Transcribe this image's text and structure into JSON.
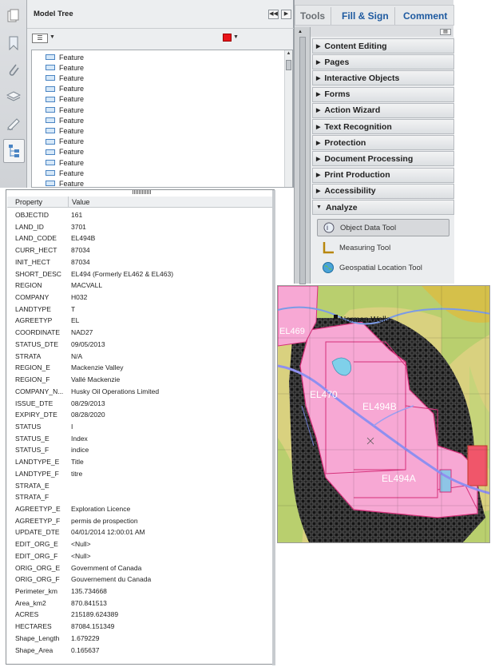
{
  "left_rail": {
    "icons": [
      "pages-icon",
      "bookmarks-icon",
      "attachments-icon",
      "layers-icon",
      "signatures-icon",
      "model-tree-icon"
    ]
  },
  "model_tree": {
    "title": "Model Tree",
    "nav_prev": "◀◀",
    "nav_next": "▶",
    "options_icon": "list-options-icon",
    "color_swatch": "#e8141a",
    "items": [
      "Feature",
      "Feature",
      "Feature",
      "Feature",
      "Feature",
      "Feature",
      "Feature",
      "Feature",
      "Feature",
      "Feature",
      "Feature",
      "Feature",
      "Feature"
    ]
  },
  "tools_panel": {
    "tabs": [
      "Tools",
      "Fill & Sign",
      "Comment"
    ],
    "accent": "#1e5aa0",
    "sections": [
      "Content Editing",
      "Pages",
      "Interactive Objects",
      "Forms",
      "Action Wizard",
      "Text Recognition",
      "Protection",
      "Document Processing",
      "Print Production",
      "Accessibility"
    ],
    "open_section": "Analyze",
    "analyze_tools": [
      {
        "label": "Object Data Tool",
        "icon": "object-data-icon"
      },
      {
        "label": "Measuring Tool",
        "icon": "ruler-icon"
      },
      {
        "label": "Geospatial Location Tool",
        "icon": "globe-icon"
      }
    ]
  },
  "properties": {
    "col_property": "Property",
    "col_value": "Value",
    "rows": [
      {
        "k": "OBJECTID",
        "v": "161"
      },
      {
        "k": "LAND_ID",
        "v": "3701"
      },
      {
        "k": "LAND_CODE",
        "v": "EL494B"
      },
      {
        "k": "CURR_HECT",
        "v": "87034"
      },
      {
        "k": "INIT_HECT",
        "v": "87034"
      },
      {
        "k": "SHORT_DESC",
        "v": "EL494 (Formerly EL462 & EL463)"
      },
      {
        "k": "REGION",
        "v": "MACVALL"
      },
      {
        "k": "COMPANY",
        "v": "H032"
      },
      {
        "k": "LANDTYPE",
        "v": "T"
      },
      {
        "k": "AGREETYP",
        "v": "EL"
      },
      {
        "k": "COORDINATE",
        "v": "NAD27"
      },
      {
        "k": "STATUS_DTE",
        "v": "09/05/2013"
      },
      {
        "k": "STRATA",
        "v": "N/A"
      },
      {
        "k": "REGION_E",
        "v": "Mackenzie Valley"
      },
      {
        "k": "REGION_F",
        "v": "Vallé Mackenzie"
      },
      {
        "k": "COMPANY_N...",
        "v": "Husky Oil Operations Limited"
      },
      {
        "k": "ISSUE_DTE",
        "v": "08/29/2013"
      },
      {
        "k": "EXPIRY_DTE",
        "v": "08/28/2020"
      },
      {
        "k": "STATUS",
        "v": "I"
      },
      {
        "k": "STATUS_E",
        "v": "Index"
      },
      {
        "k": "STATUS_F",
        "v": "indice"
      },
      {
        "k": "LANDTYPE_E",
        "v": "Title"
      },
      {
        "k": "LANDTYPE_F",
        "v": "titre"
      },
      {
        "k": "STRATA_E",
        "v": ""
      },
      {
        "k": "STRATA_F",
        "v": ""
      },
      {
        "k": "AGREETYP_E",
        "v": "Exploration Licence"
      },
      {
        "k": "AGREETYP_F",
        "v": "permis de prospection"
      },
      {
        "k": "UPDATE_DTE",
        "v": "04/01/2014 12:00:01 AM"
      },
      {
        "k": "EDIT_ORG_E",
        "v": "<Null>"
      },
      {
        "k": "EDIT_ORG_F",
        "v": "<Null>"
      },
      {
        "k": "ORIG_ORG_E",
        "v": "Government of Canada"
      },
      {
        "k": "ORIG_ORG_F",
        "v": "Gouvernement du Canada"
      },
      {
        "k": "Perimeter_km",
        "v": "135.734668"
      },
      {
        "k": "Area_km2",
        "v": "870.841513"
      },
      {
        "k": "ACRES",
        "v": "215189.624389"
      },
      {
        "k": "HECTARES",
        "v": "87084.151349"
      },
      {
        "k": "Shape_Length",
        "v": "1.679229"
      },
      {
        "k": "Shape_Area",
        "v": "0.165637"
      }
    ]
  },
  "map": {
    "labels": {
      "town": "Norman Wells",
      "el469": "EL469",
      "el470": "EL470",
      "el494b": "EL494B",
      "el494a": "EL494A"
    },
    "colors": {
      "parcel": "#f7a8d4",
      "parcel_border": "#d5307a",
      "label": "#ffffff"
    }
  }
}
